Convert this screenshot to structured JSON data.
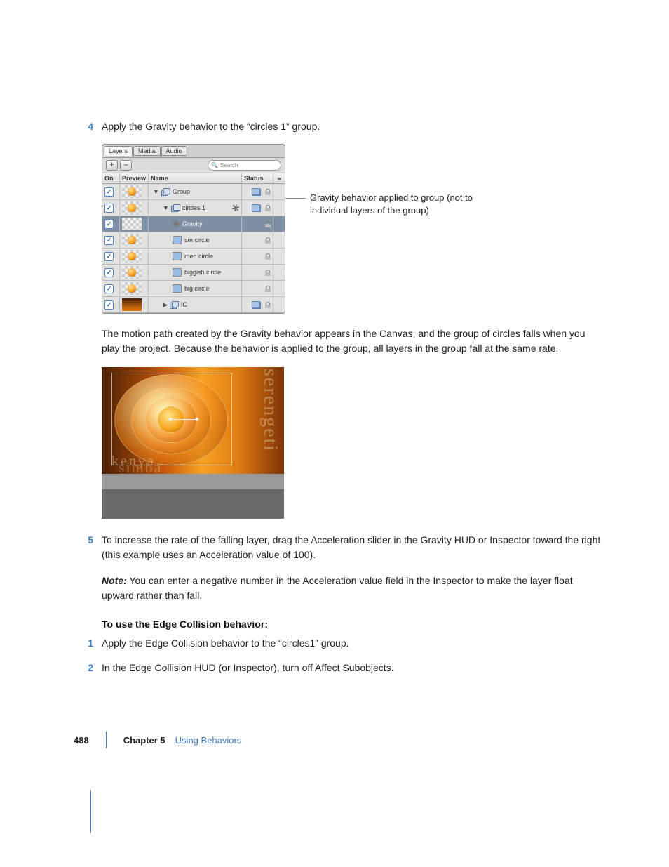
{
  "steps_a": {
    "n4": "4",
    "t4": "Apply the Gravity behavior to the “circles 1” group."
  },
  "layers": {
    "tabs": [
      "Layers",
      "Media",
      "Audio"
    ],
    "btn_plus": "+",
    "btn_minus": "–",
    "search_icon": "🔍",
    "search_placeholder": "Search",
    "headers": {
      "on": "On",
      "preview": "Preview",
      "name": "Name",
      "status": "Status",
      "spill": "»"
    },
    "rows": [
      {
        "name": "Group",
        "indent": 0,
        "disc": "▼",
        "type": "group",
        "selected": false
      },
      {
        "name": "circles 1",
        "indent": 1,
        "disc": "▼",
        "type": "group",
        "selected": false,
        "gear": true,
        "underline": true
      },
      {
        "name": "Gravity",
        "indent": 2,
        "disc": "",
        "type": "behavior",
        "selected": true
      },
      {
        "name": "sm circle",
        "indent": 2,
        "disc": "",
        "type": "layer",
        "selected": false
      },
      {
        "name": "med circle",
        "indent": 2,
        "disc": "",
        "type": "layer",
        "selected": false
      },
      {
        "name": "biggish circle",
        "indent": 2,
        "disc": "",
        "type": "layer",
        "selected": false
      },
      {
        "name": "big circle",
        "indent": 2,
        "disc": "",
        "type": "layer",
        "selected": false
      },
      {
        "name": "IC",
        "indent": 1,
        "disc": "▶",
        "type": "group",
        "selected": false,
        "scene": true
      }
    ]
  },
  "annotation": "Gravity behavior applied to group (not to individual layers of the group)",
  "para1": "The motion path created by the Gravity behavior appears in the Canvas, and the group of circles falls when you play the project. Because the behavior is applied to the group, all layers in the group fall at the same rate.",
  "canvas": {
    "word_right": "serengeti",
    "word_kenya": "kenya",
    "word_simba": "simba"
  },
  "steps_b": {
    "n5": "5",
    "t5": "To increase the rate of the falling layer, drag the Acceleration slider in the Gravity HUD or Inspector toward the right (this example uses an Acceleration value of 100).",
    "note_label": "Note:",
    "note_body": " You can enter a negative number in the Acceleration value field in the Inspector to make the layer float upward rather than fall."
  },
  "subproc": {
    "title": "To use the Edge Collision behavior:",
    "n1": "1",
    "t1": "Apply the Edge Collision behavior to the “circles1” group.",
    "n2": "2",
    "t2": "In the Edge Collision HUD (or Inspector), turn off Affect Subobjects."
  },
  "footer": {
    "page": "488",
    "chapter": "Chapter 5",
    "title": "Using Behaviors"
  }
}
